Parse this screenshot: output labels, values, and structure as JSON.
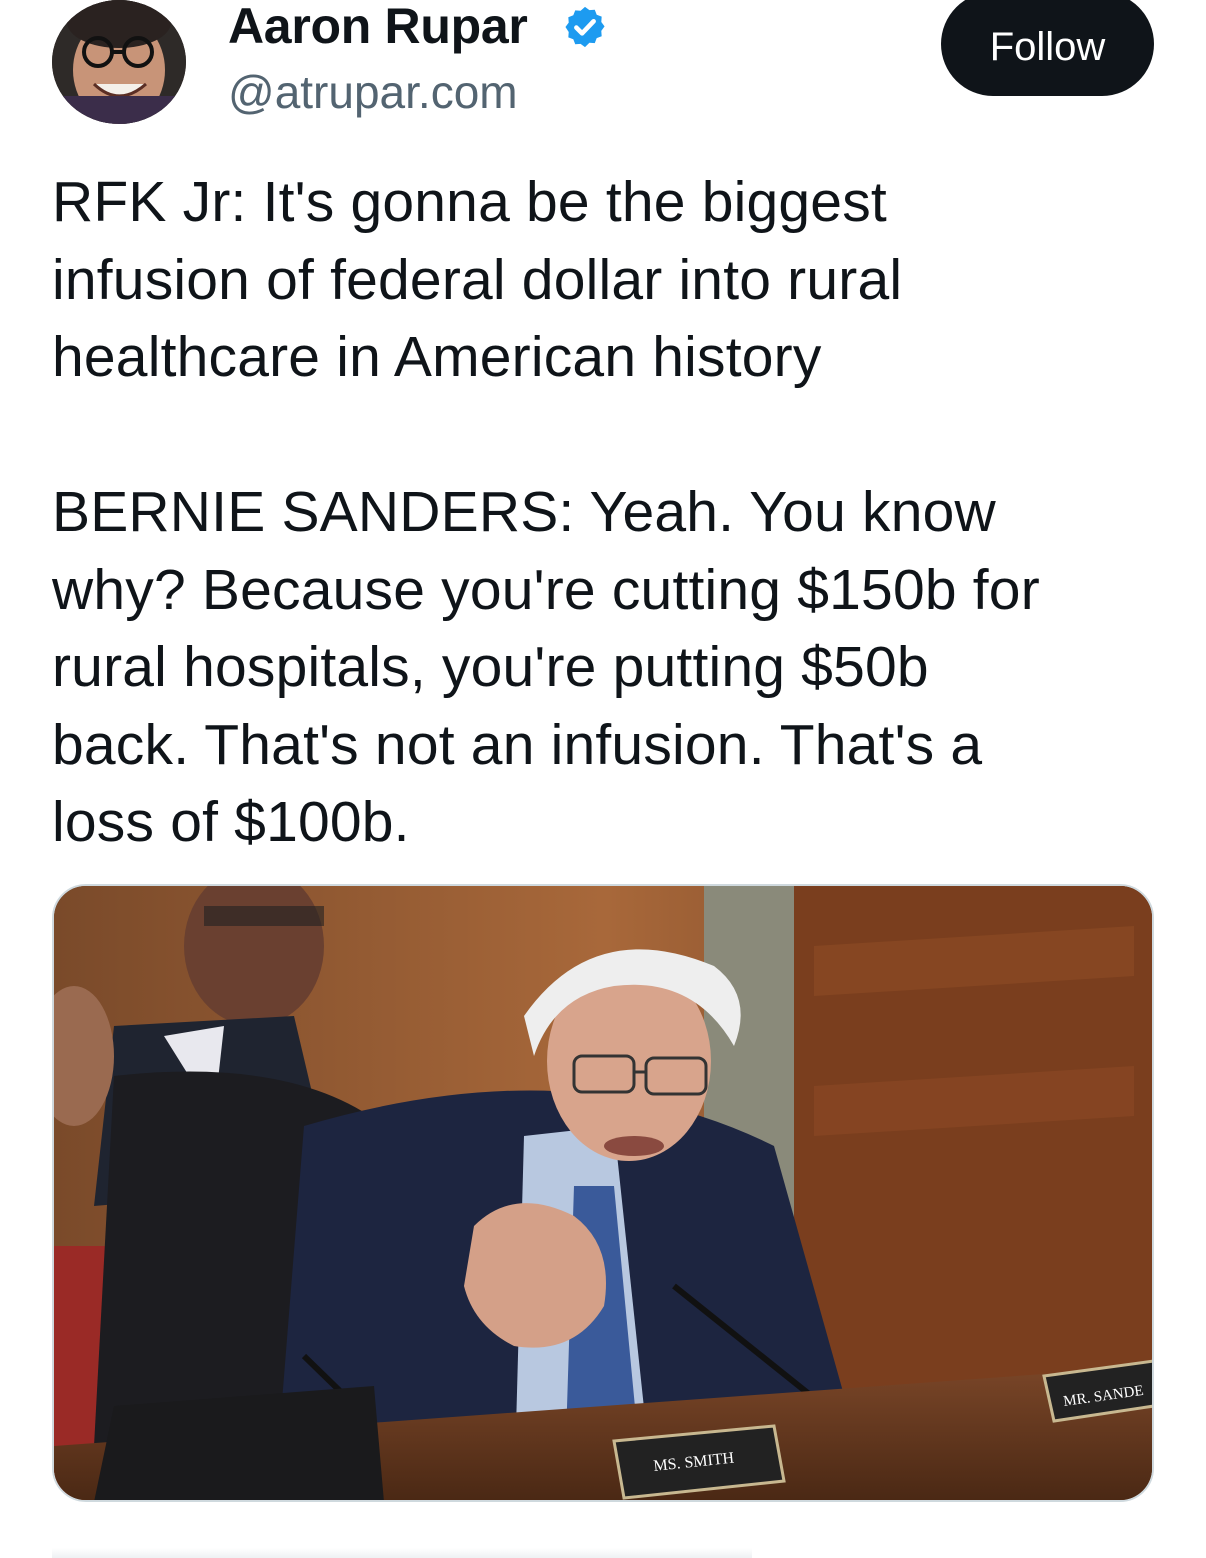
{
  "author": {
    "name": "Aaron Rupar",
    "handle": "@atrupar.com",
    "verified_icon": "verified-check-icon",
    "verified_color": "#1d9bf0"
  },
  "follow_button": {
    "label": "Follow",
    "background": "#0f1419",
    "text_color": "#ffffff"
  },
  "tweet": {
    "lines_part1": [
      "RFK Jr: It's gonna be the biggest",
      "infusion of federal dollar into rural",
      "healthcare in American history"
    ],
    "lines_part2": [
      "BERNIE SANDERS: Yeah. You know",
      "why? Because you're cutting $150b for",
      "rural hospitals, you're putting $50b",
      "back. That's not an infusion. That's a",
      "loss of $100b."
    ]
  },
  "media": {
    "nameplate_left": "MS. SMITH",
    "nameplate_right": "MR. SANDE"
  }
}
